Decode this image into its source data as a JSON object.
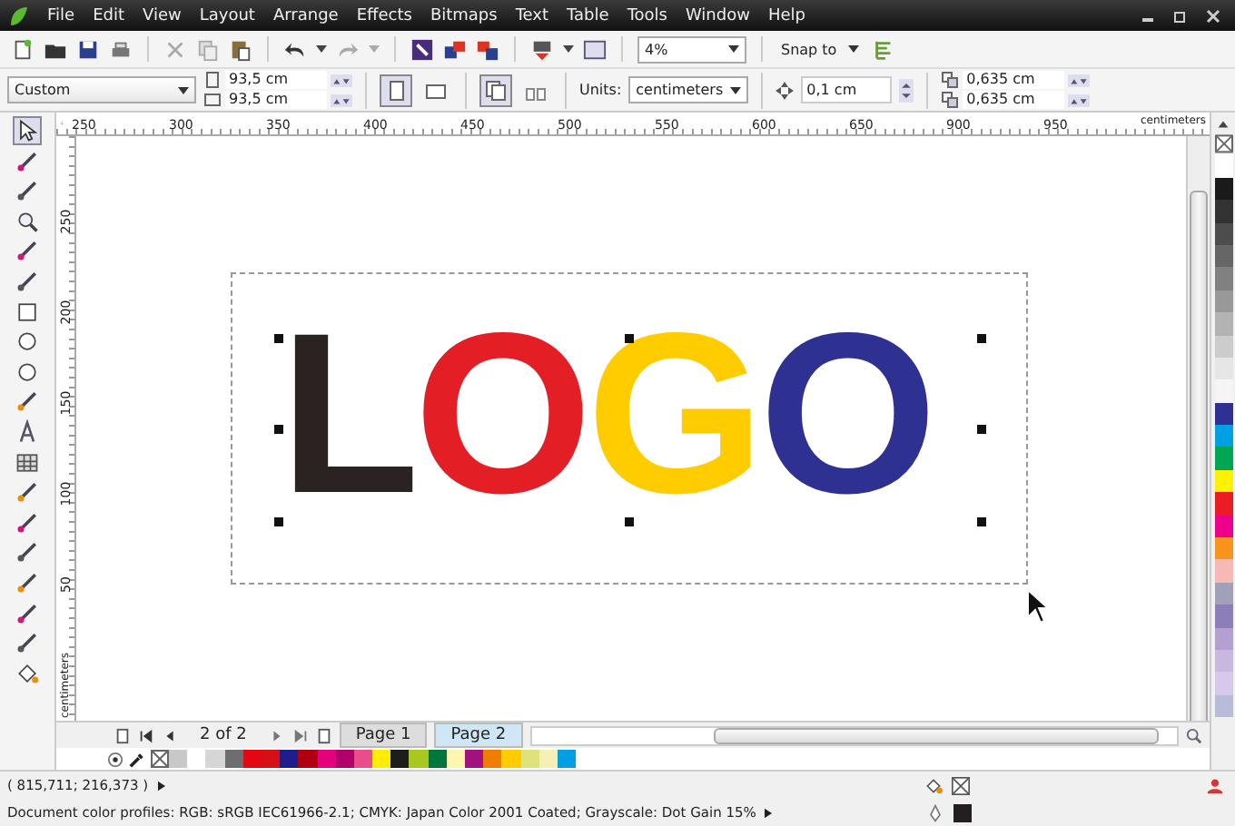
{
  "menu": [
    "File",
    "Edit",
    "View",
    "Layout",
    "Arrange",
    "Effects",
    "Bitmaps",
    "Text",
    "Table",
    "Tools",
    "Window",
    "Help"
  ],
  "toolbar": {
    "zoom": "4%",
    "snap": "Snap to"
  },
  "property_bar": {
    "preset": "Custom",
    "width": "93,5 cm",
    "height": "93,5 cm",
    "portrait": true,
    "all_pages": true,
    "units_label": "Units:",
    "units": "centimeters",
    "nudge": "0,1 cm",
    "duplicate_x": "0,635 cm",
    "duplicate_y": "0,635 cm"
  },
  "ruler": {
    "h_labels": [
      "250",
      "300",
      "350",
      "400",
      "450",
      "500",
      "550",
      "600",
      "650",
      "900",
      "950"
    ],
    "h_unit": "centimeters",
    "v_labels": [
      "250",
      "200",
      "150",
      "100",
      "50"
    ],
    "v_unit": "centimeters"
  },
  "logo": [
    {
      "letter": "L",
      "color": "#2b2321"
    },
    {
      "letter": "O",
      "color": "#e31e24"
    },
    {
      "letter": "G",
      "color": "#ffcc00"
    },
    {
      "letter": "O",
      "color": "#2e3192"
    }
  ],
  "pages": {
    "counter": "2 of 2",
    "tabs": [
      {
        "label": "Page 1",
        "selected": false
      },
      {
        "label": "Page 2",
        "selected": true
      }
    ]
  },
  "palette": [
    {
      "color": "#c8c8c8"
    },
    {
      "color": "#ffffff"
    },
    {
      "color": "#d6d6d6"
    },
    {
      "color": "#6e6e6e"
    },
    {
      "color": "#e30613"
    },
    {
      "color": "#d40f16"
    },
    {
      "color": "#1d1d8c"
    },
    {
      "color": "#b00010"
    },
    {
      "color": "#e5007e"
    },
    {
      "color": "#b0006a"
    },
    {
      "color": "#e94e8b"
    },
    {
      "color": "#ffed00"
    },
    {
      "color": "#1d1d1b"
    },
    {
      "color": "#a8c81e"
    },
    {
      "color": "#00763c"
    },
    {
      "color": "#fdf6b0"
    },
    {
      "color": "#a3117e"
    },
    {
      "color": "#ef7d00"
    },
    {
      "color": "#ffcc00"
    },
    {
      "color": "#dde37a"
    },
    {
      "color": "#f6f0b6"
    },
    {
      "color": "#009fe3"
    }
  ],
  "side_palette": [
    {
      "color": "#ffffff"
    },
    {
      "color": "#1a1a1a"
    },
    {
      "color": "#333333"
    },
    {
      "color": "#4d4d4d"
    },
    {
      "color": "#666666"
    },
    {
      "color": "#808080"
    },
    {
      "color": "#999999"
    },
    {
      "color": "#b3b3b3"
    },
    {
      "color": "#cccccc"
    },
    {
      "color": "#e6e6e6"
    },
    {
      "color": "#f5f5f5"
    },
    {
      "color": "#2e3192"
    },
    {
      "color": "#00a0e3"
    },
    {
      "color": "#00a651"
    },
    {
      "color": "#fff200"
    },
    {
      "color": "#ec1c24"
    },
    {
      "color": "#ec008c"
    },
    {
      "color": "#f7941d"
    },
    {
      "color": "#f6b9b4"
    },
    {
      "color": "#a0a0b8"
    },
    {
      "color": "#8c7fb8"
    },
    {
      "color": "#b3a0d0"
    },
    {
      "color": "#c8b8e0"
    },
    {
      "color": "#d8c8ec"
    },
    {
      "color": "#b8bcd8"
    }
  ],
  "status": {
    "coords": "( 815,711; 216,373 )",
    "profiles": "Document color profiles: RGB: sRGB IEC61966-2.1; CMYK: Japan Color 2001 Coated; Grayscale: Dot Gain 15%"
  }
}
